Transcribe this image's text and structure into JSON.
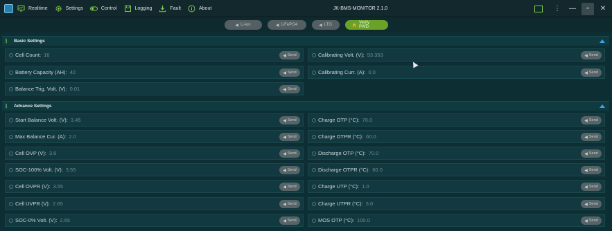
{
  "menu": {
    "items": [
      {
        "label": "Realtime",
        "icon": "monitor-icon"
      },
      {
        "label": "Settings",
        "icon": "gear-icon"
      },
      {
        "label": "Control",
        "icon": "toggle-icon"
      },
      {
        "label": "Logging",
        "icon": "save-icon"
      },
      {
        "label": "Fault",
        "icon": "download-icon"
      },
      {
        "label": "About",
        "icon": "info-icon"
      }
    ]
  },
  "window": {
    "title": "JK-BMS-MONITOR 2.1.0",
    "controls": [
      "monitor",
      "⋮",
      "—",
      "▫",
      "✕"
    ]
  },
  "toolbar": {
    "buttons": [
      "Li-ion",
      "LiFePO4",
      "LTO"
    ],
    "verify_label": "Verify PWD."
  },
  "send_label": "Send",
  "basic": {
    "title": "Basic Settings",
    "left": [
      {
        "label": "Cell Count:",
        "value": "16"
      },
      {
        "label": "Battery Capacity (AH):",
        "value": "40"
      },
      {
        "label": "Balance Trig. Volt. (V):",
        "value": "0.01"
      }
    ],
    "right": [
      {
        "label": "Calibrating Volt. (V):",
        "value": "53.353"
      },
      {
        "label": "Calibrating Curr. (A):",
        "value": "0.0"
      }
    ]
  },
  "advance": {
    "title": "Advance Settings",
    "left": [
      {
        "label": "Start Balance Volt. (V):",
        "value": "3.45"
      },
      {
        "label": "Max Balance Cur. (A):",
        "value": "2.0"
      },
      {
        "label": "Cell OVP (V):",
        "value": "3.6"
      },
      {
        "label": "SOC-100% Volt. (V):",
        "value": "3.55"
      },
      {
        "label": "Cell OVPR (V):",
        "value": "3.55"
      },
      {
        "label": "Cell UVPR (V):",
        "value": "2.65"
      },
      {
        "label": "SOC-0% Volt. (V):",
        "value": "2.65"
      }
    ],
    "right": [
      {
        "label": "Charge OTP (°C):",
        "value": "70.0"
      },
      {
        "label": "Charge OTPR (°C):",
        "value": "60.0"
      },
      {
        "label": "Discharge OTP (°C):",
        "value": "70.0"
      },
      {
        "label": "Discharge OTPR (°C):",
        "value": "60.0"
      },
      {
        "label": "Charge UTP (°C):",
        "value": "1.0"
      },
      {
        "label": "Charge UTPR (°C):",
        "value": "3.0"
      },
      {
        "label": "MOS OTP (°C):",
        "value": "100.0"
      }
    ]
  }
}
